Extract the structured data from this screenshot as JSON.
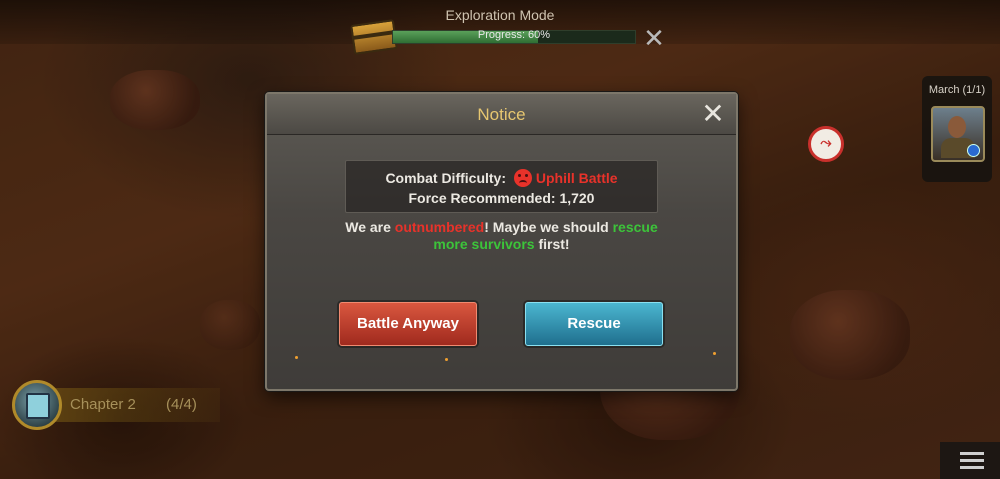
{
  "header": {
    "mode_title": "Exploration Mode",
    "progress_text": "Progress: 60%",
    "progress_value": 0.6,
    "close_icon": "close-icon"
  },
  "march": {
    "label": "March (1/1)"
  },
  "chapter": {
    "name": "Chapter 2",
    "count": "(4/4)"
  },
  "dialog": {
    "title": "Notice",
    "difficulty_label": "Combat Difficulty:",
    "difficulty_value": "Uphill Battle",
    "force_label": "Force Recommended:",
    "force_value": "1,720",
    "message_part1": "We are ",
    "message_red": "outnumbered",
    "message_part2": "! Maybe we should ",
    "message_green": "rescue more survivors",
    "message_part3": " first!",
    "battle_button": "Battle Anyway",
    "rescue_button": "Rescue"
  },
  "colors": {
    "danger": "#e8322a",
    "success": "#3cc43a",
    "title_gold": "#e6c670"
  }
}
